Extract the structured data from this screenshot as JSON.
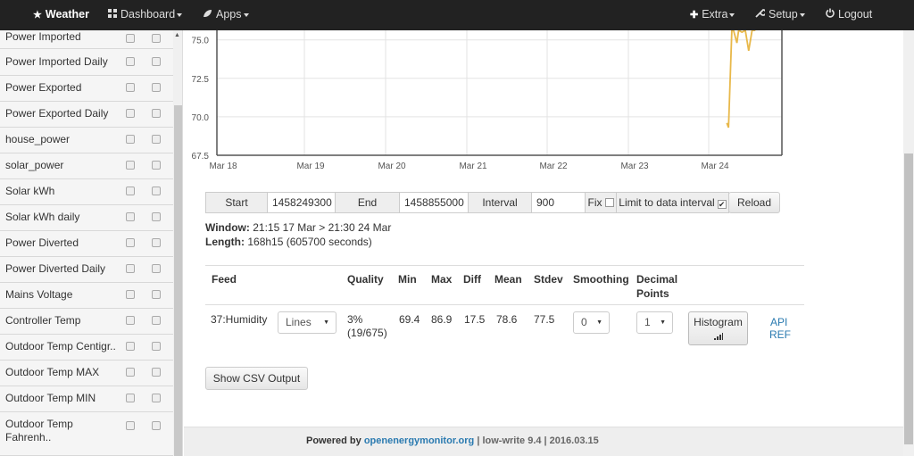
{
  "navbar": {
    "brand": "Weather",
    "dashboard": "Dashboard",
    "apps": "Apps",
    "extra": "Extra",
    "setup": "Setup",
    "logout": "Logout"
  },
  "sidebar": {
    "items": [
      {
        "label": "Power Imported"
      },
      {
        "label": "Power Imported Daily"
      },
      {
        "label": "Power Exported"
      },
      {
        "label": "Power Exported Daily"
      },
      {
        "label": "house_power"
      },
      {
        "label": "solar_power"
      },
      {
        "label": "Solar kWh"
      },
      {
        "label": "Solar kWh daily"
      },
      {
        "label": "Power Diverted"
      },
      {
        "label": "Power Diverted Daily"
      },
      {
        "label": "Mains Voltage"
      },
      {
        "label": "Controller Temp"
      },
      {
        "label": "Outdoor Temp Centigr.."
      },
      {
        "label": "Outdoor Temp MAX"
      },
      {
        "label": "Outdoor Temp MIN"
      },
      {
        "label": "Outdoor Temp Fahrenh.."
      }
    ]
  },
  "chart_data": {
    "type": "line",
    "xlabel": "",
    "ylabel": "",
    "x_ticks": [
      "Mar 18",
      "Mar 19",
      "Mar 20",
      "Mar 21",
      "Mar 22",
      "Mar 23",
      "Mar 24"
    ],
    "y_ticks": [
      "67.5",
      "70.0",
      "72.5",
      "75.0"
    ],
    "ylim": [
      67.5,
      76.2
    ],
    "grid": true,
    "series": [
      {
        "color": "#e8b84a",
        "points": [
          {
            "x": "Mar 24 07:30",
            "y": 69.6
          },
          {
            "x": "Mar 24 08:00",
            "y": 69.3
          },
          {
            "x": "Mar 24 09:00",
            "y": 75.6
          },
          {
            "x": "Mar 24 09:30",
            "y": 76.2
          },
          {
            "x": "Mar 24 10:30",
            "y": 74.8
          },
          {
            "x": "Mar 24 11:00",
            "y": 76.2
          },
          {
            "x": "Mar 24 12:00",
            "y": 75.5
          },
          {
            "x": "Mar 24 13:00",
            "y": 76.2
          },
          {
            "x": "Mar 24 14:00",
            "y": 74.3
          },
          {
            "x": "Mar 24 15:00",
            "y": 76.2
          },
          {
            "x": "Mar 24 16:00",
            "y": 76.2
          }
        ]
      }
    ]
  },
  "controls": {
    "start_label": "Start",
    "start_value": "1458249300",
    "end_label": "End",
    "end_value": "1458855000",
    "interval_label": "Interval",
    "interval_value": "900",
    "fix_label": "Fix",
    "limit_label": "Limit to data interval",
    "limit_check": "✔",
    "reload_label": "Reload"
  },
  "info": {
    "window_label": "Window:",
    "window_value": "21:15 17 Mar > 21:30 24 Mar",
    "length_label": "Length:",
    "length_value": "168h15 (605700 seconds)"
  },
  "table": {
    "headers": {
      "feed": "Feed",
      "quality": "Quality",
      "min": "Min",
      "max": "Max",
      "diff": "Diff",
      "mean": "Mean",
      "stdev": "Stdev",
      "smoothing": "Smoothing",
      "decimal_1": "Decimal",
      "decimal_2": "Points"
    },
    "row": {
      "feed": "37:Humidity",
      "type": "Lines",
      "quality_1": "3%",
      "quality_2": "(19/675)",
      "min": "69.4",
      "max": "86.9",
      "diff": "17.5",
      "mean": "78.6",
      "stdev": "77.5",
      "smoothing": "0",
      "decimal": "1",
      "histogram": "Histogram",
      "api_1": "API",
      "api_2": "REF"
    }
  },
  "csv_button": "Show CSV Output",
  "footer": {
    "powered": "Powered by",
    "site": "openenergymonitor.org",
    "version": "| low-write 9.4 | 2016.03.15"
  }
}
